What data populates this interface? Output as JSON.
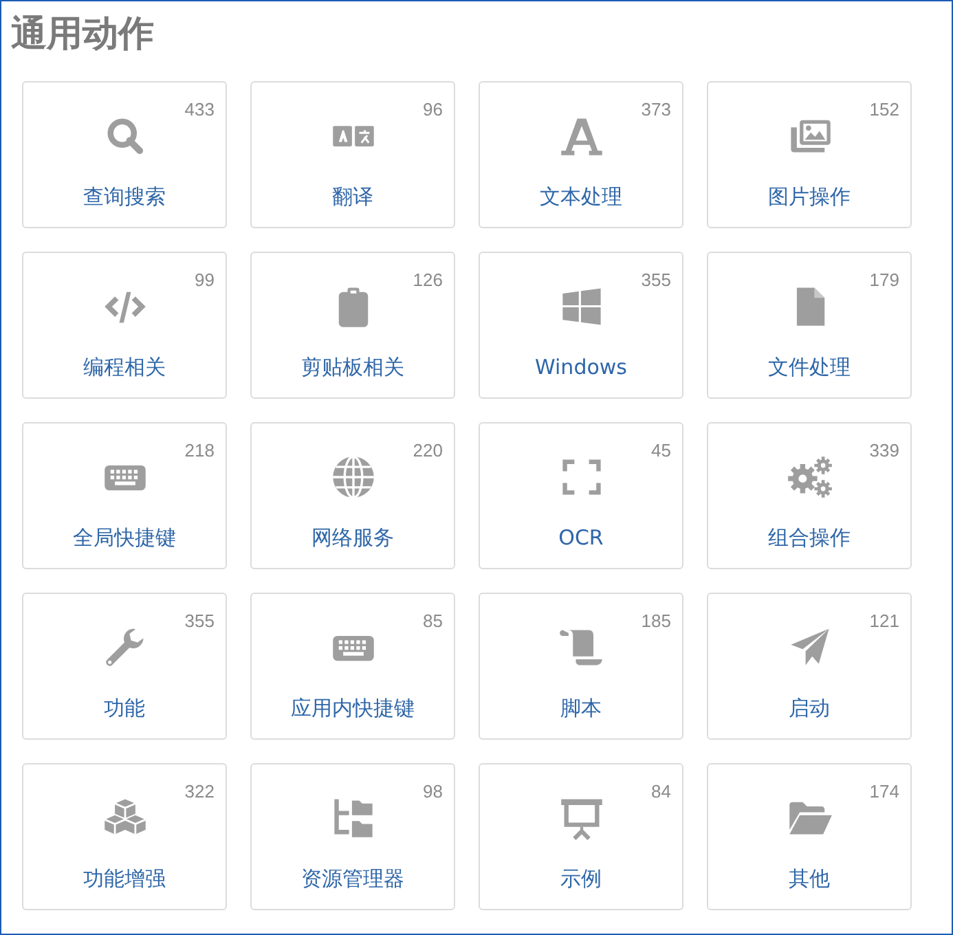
{
  "title": "通用动作",
  "categories": [
    {
      "label": "查询搜索",
      "count": "433",
      "kind": "search"
    },
    {
      "label": "翻译",
      "count": "96",
      "kind": "translate"
    },
    {
      "label": "文本处理",
      "count": "373",
      "kind": "font"
    },
    {
      "label": "图片操作",
      "count": "152",
      "kind": "images"
    },
    {
      "label": "编程相关",
      "count": "99",
      "kind": "code"
    },
    {
      "label": "剪贴板相关",
      "count": "126",
      "kind": "clipboard"
    },
    {
      "label": "Windows",
      "count": "355",
      "kind": "windows"
    },
    {
      "label": "文件处理",
      "count": "179",
      "kind": "file"
    },
    {
      "label": "全局快捷键",
      "count": "218",
      "kind": "keyboard"
    },
    {
      "label": "网络服务",
      "count": "220",
      "kind": "globe"
    },
    {
      "label": "OCR",
      "count": "45",
      "kind": "corners"
    },
    {
      "label": "组合操作",
      "count": "339",
      "kind": "gears"
    },
    {
      "label": "功能",
      "count": "355",
      "kind": "wrench"
    },
    {
      "label": "应用内快捷键",
      "count": "85",
      "kind": "keyboard"
    },
    {
      "label": "脚本",
      "count": "185",
      "kind": "scroll"
    },
    {
      "label": "启动",
      "count": "121",
      "kind": "plane"
    },
    {
      "label": "功能增强",
      "count": "322",
      "kind": "cubes"
    },
    {
      "label": "资源管理器",
      "count": "98",
      "kind": "tree"
    },
    {
      "label": "示例",
      "count": "84",
      "kind": "board"
    },
    {
      "label": "其他",
      "count": "174",
      "kind": "folder"
    }
  ]
}
